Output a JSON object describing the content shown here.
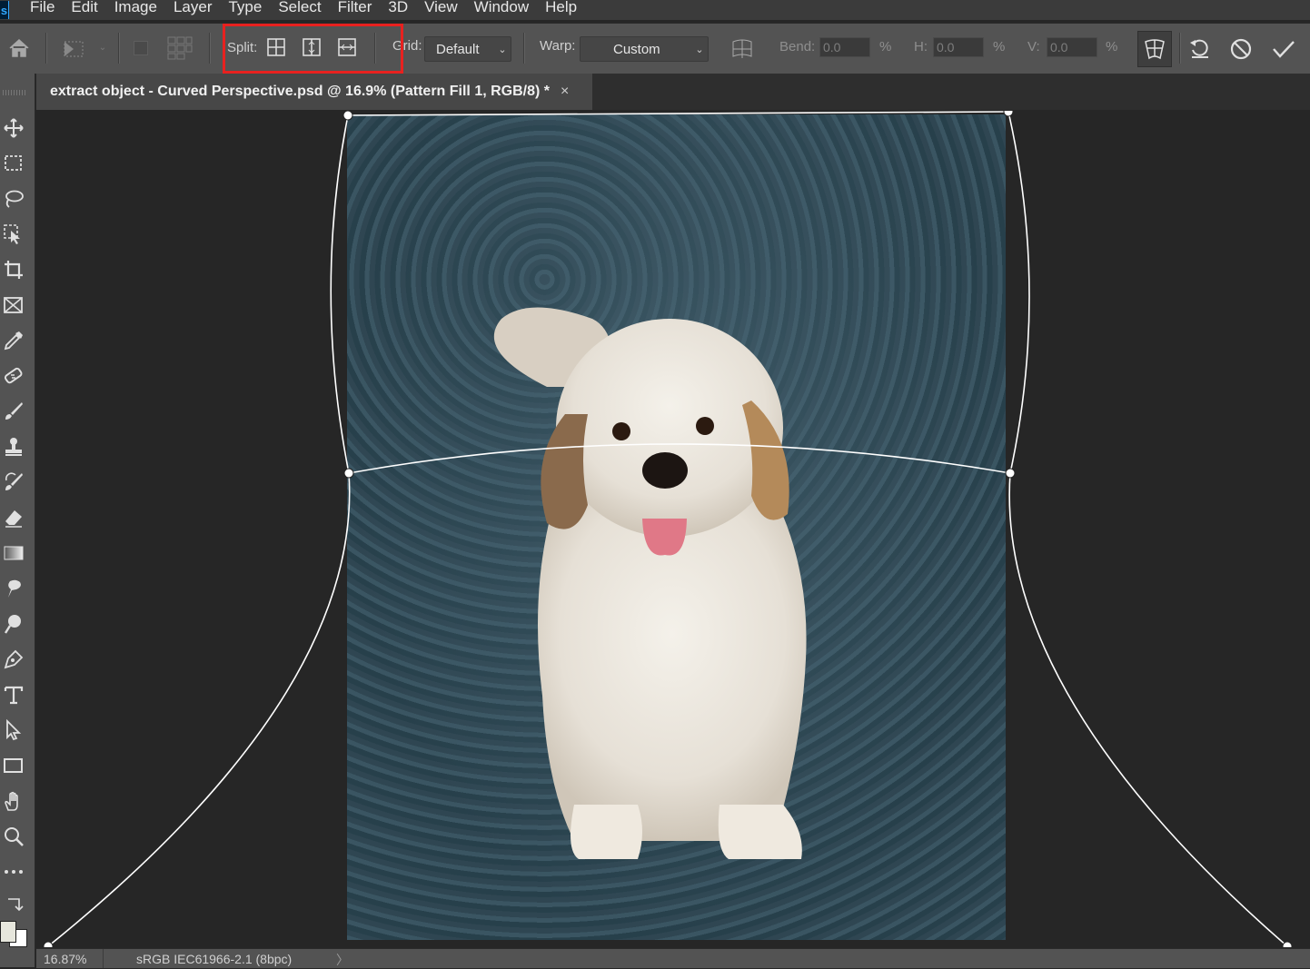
{
  "menu": [
    "File",
    "Edit",
    "Image",
    "Layer",
    "Type",
    "Select",
    "Filter",
    "3D",
    "View",
    "Window",
    "Help"
  ],
  "options": {
    "split_label": "Split:",
    "grid_label": "Grid:",
    "grid_value": "Default",
    "warp_label": "Warp:",
    "warp_value": "Custom",
    "bend_label": "Bend:",
    "bend_value": "0.0",
    "bend_unit": "%",
    "h_label": "H:",
    "h_value": "0.0",
    "h_unit": "%",
    "v_label": "V:",
    "v_value": "0.0",
    "v_unit": "%"
  },
  "document": {
    "tab_title": "extract object - Curved Perspective.psd @ 16.9% (Pattern Fill 1, RGB/8) *",
    "close_symbol": "×"
  },
  "status": {
    "zoom": "16.87%",
    "color_profile": "sRGB IEC61966-2.1 (8bpc)",
    "arrow": "〉"
  },
  "colors": {
    "highlight_box": "#e8211f",
    "panel_bg": "#535353",
    "canvas_bg": "#262626",
    "backdrop": "#314a57"
  },
  "tools": [
    "move-icon",
    "marquee-icon",
    "lasso-icon",
    "object-select-icon",
    "crop-icon",
    "frame-icon",
    "eyedropper-icon",
    "healing-icon",
    "brush-icon",
    "stamp-icon",
    "history-brush-icon",
    "eraser-icon",
    "gradient-icon",
    "smudge-icon",
    "dodge-icon",
    "pen-icon",
    "type-icon",
    "path-select-icon",
    "rectangle-icon",
    "hand-icon",
    "zoom-icon",
    "more-icon"
  ]
}
